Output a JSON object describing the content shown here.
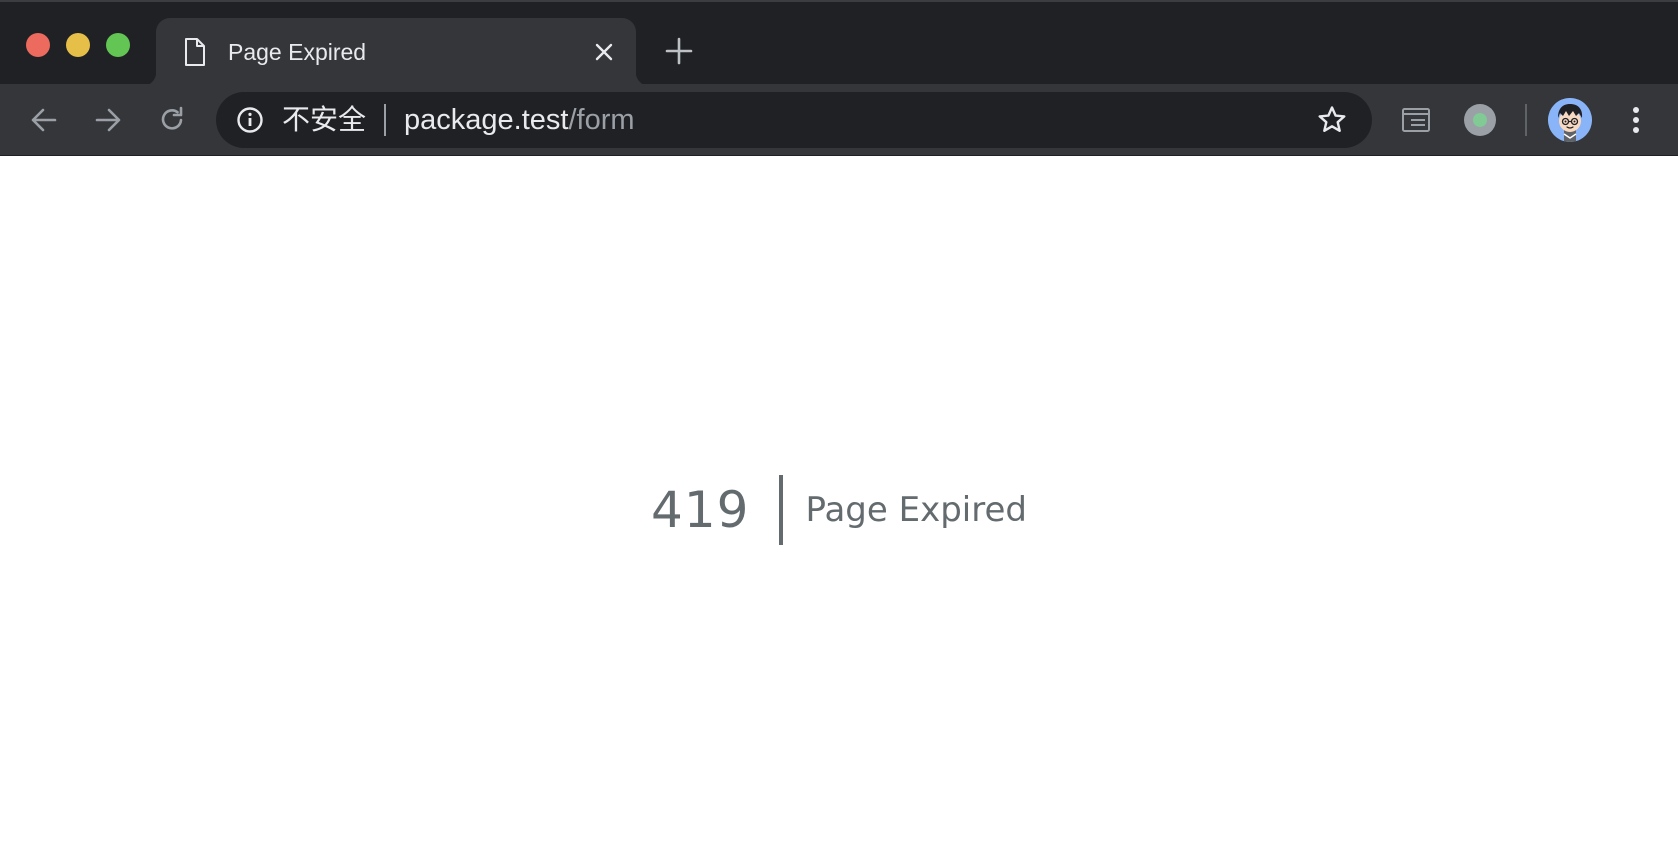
{
  "window": {
    "controls": [
      "close",
      "minimize",
      "maximize"
    ]
  },
  "tab": {
    "title": "Page Expired",
    "favicon": "page-icon",
    "close_icon": "close-icon"
  },
  "new_tab_icon": "plus-icon",
  "toolbar": {
    "back_icon": "arrow-left-icon",
    "forward_icon": "arrow-right-icon",
    "reload_icon": "reload-icon",
    "security_icon": "info-icon",
    "security_label": "不安全",
    "url_host": "package.test",
    "url_path": "/form",
    "bookmark_icon": "star-icon",
    "extension_icons": [
      "window-icon",
      "circle-dot-icon"
    ],
    "profile_icon": "avatar",
    "menu_icon": "more-vertical-icon"
  },
  "page": {
    "error_code": "419",
    "error_message": "Page Expired"
  },
  "colors": {
    "tabstrip_bg": "#202124",
    "toolbar_bg": "#35363a",
    "omnibox_bg": "#202124",
    "error_text": "#636b6f",
    "traffic_red": "#ec6a5e",
    "traffic_yellow": "#e6bf48",
    "traffic_green": "#62c554"
  }
}
